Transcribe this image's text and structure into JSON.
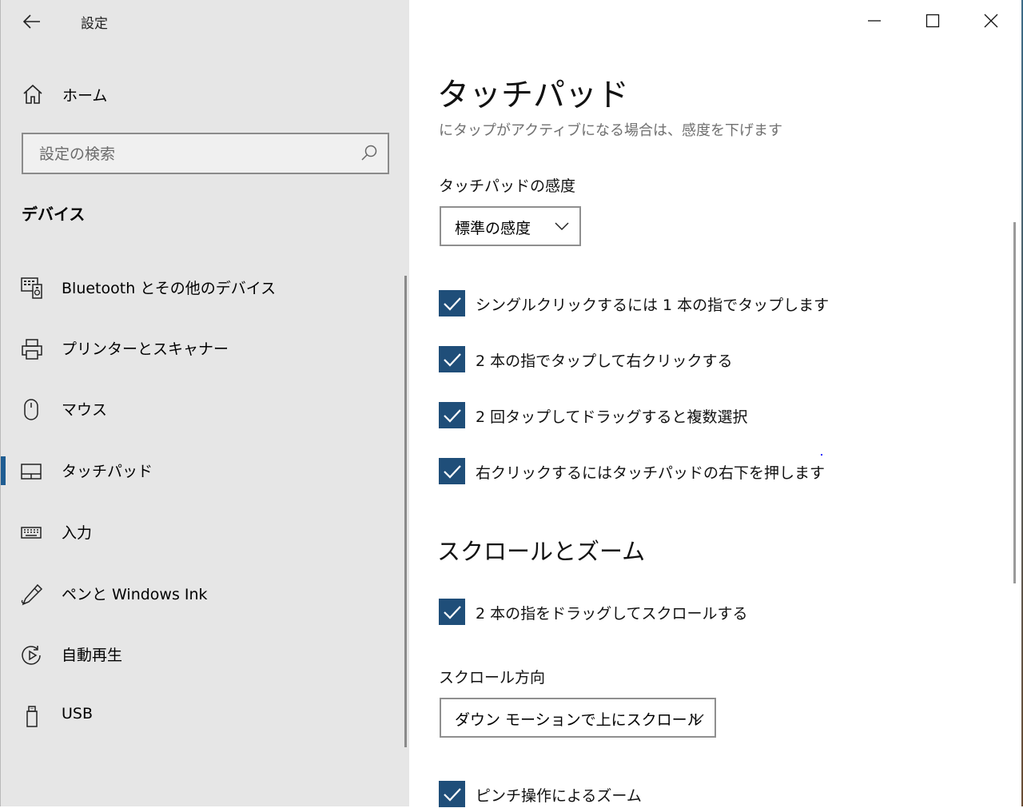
{
  "window": {
    "app_title": "設定",
    "controls": {
      "minimize": "minimize",
      "maximize": "maximize",
      "close": "close"
    }
  },
  "sidebar": {
    "home_label": "ホーム",
    "search_placeholder": "設定の検索",
    "section_title": "デバイス",
    "items": [
      {
        "label": "Bluetooth とその他のデバイス",
        "icon": "bluetooth-devices-icon"
      },
      {
        "label": "プリンターとスキャナー",
        "icon": "printer-icon"
      },
      {
        "label": "マウス",
        "icon": "mouse-icon"
      },
      {
        "label": "タッチパッド",
        "icon": "touchpad-icon",
        "active": true
      },
      {
        "label": "入力",
        "icon": "keyboard-icon"
      },
      {
        "label": "ペンと Windows Ink",
        "icon": "pen-icon"
      },
      {
        "label": "自動再生",
        "icon": "autoplay-icon"
      },
      {
        "label": "USB",
        "icon": "usb-icon"
      }
    ]
  },
  "main": {
    "title": "タッチパッド",
    "subtitle": "にタップがアクティブになる場合は、感度を下げます",
    "sensitivity_label": "タッチパッドの感度",
    "sensitivity_value": "標準の感度",
    "taps": [
      {
        "label": "シングルクリックするには 1 本の指でタップします",
        "checked": true
      },
      {
        "label": "2 本の指でタップして右クリックする",
        "checked": true
      },
      {
        "label": "2 回タップしてドラッグすると複数選択",
        "checked": true
      },
      {
        "label": "右クリックするにはタッチパッドの右下を押します",
        "checked": true
      }
    ],
    "scroll_section_title": "スクロールとズーム",
    "scroll_drag": {
      "label": "2 本の指をドラッグしてスクロールする",
      "checked": true
    },
    "scroll_direction_label": "スクロール方向",
    "scroll_direction_value": "ダウン モーションで上にスクロール",
    "pinch_zoom": {
      "label": "ピンチ操作によるズーム",
      "checked": true
    }
  },
  "colors": {
    "accent": "#1f4e79",
    "sidebar_bg": "#e6e6e6",
    "active_indicator": "#1f5d92"
  }
}
